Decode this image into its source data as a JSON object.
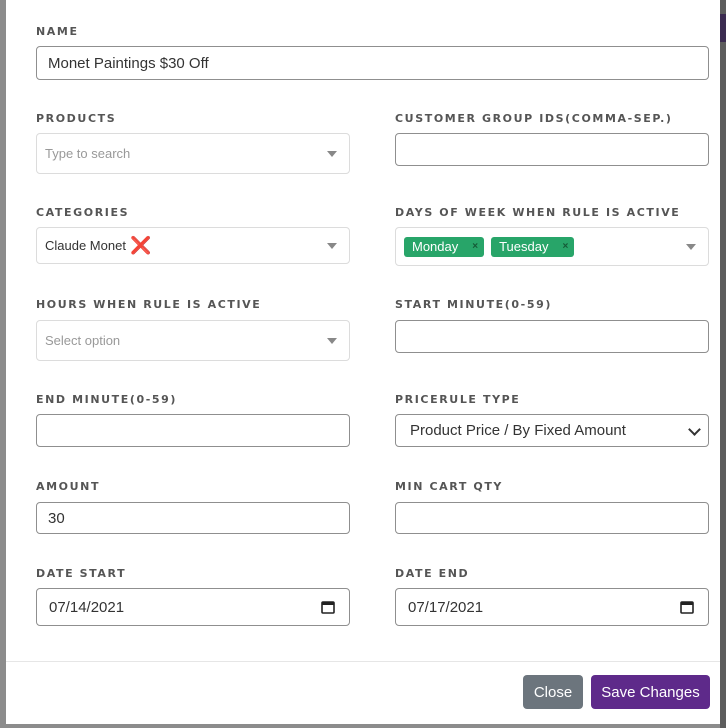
{
  "form": {
    "name": {
      "label": "NAME",
      "value": "Monet Paintings $30 Off"
    },
    "products": {
      "label": "PRODUCTS",
      "placeholder": "Type to search"
    },
    "customer_group_ids": {
      "label": "CUSTOMER GROUP IDS(COMMA-SEP.)",
      "value": ""
    },
    "categories": {
      "label": "CATEGORIES",
      "selected": "Claude Monet",
      "remove_icon": "❌"
    },
    "days_of_week": {
      "label": "DAYS OF WEEK WHEN RULE IS ACTIVE",
      "tags": [
        "Monday",
        "Tuesday"
      ],
      "tag_remove": "×"
    },
    "hours": {
      "label": "HOURS WHEN RULE IS ACTIVE",
      "placeholder": "Select option"
    },
    "start_minute": {
      "label": "START MINUTE(0-59)",
      "value": ""
    },
    "end_minute": {
      "label": "END MINUTE(0-59)",
      "value": ""
    },
    "pricerule_type": {
      "label": "PRICERULE TYPE",
      "selected": "Product Price / By Fixed Amount"
    },
    "amount": {
      "label": "AMOUNT",
      "value": "30"
    },
    "min_cart_qty": {
      "label": "MIN CART QTY",
      "value": ""
    },
    "date_start": {
      "label": "DATE START",
      "value": "07/14/2021"
    },
    "date_end": {
      "label": "DATE END",
      "value": "07/17/2021"
    }
  },
  "footer": {
    "close_label": "Close",
    "save_label": "Save Changes"
  },
  "colors": {
    "tag_bg": "#28a569",
    "close_bg": "#6c757d",
    "save_bg": "#5e2a8a",
    "remove_red": "#e0282f"
  }
}
